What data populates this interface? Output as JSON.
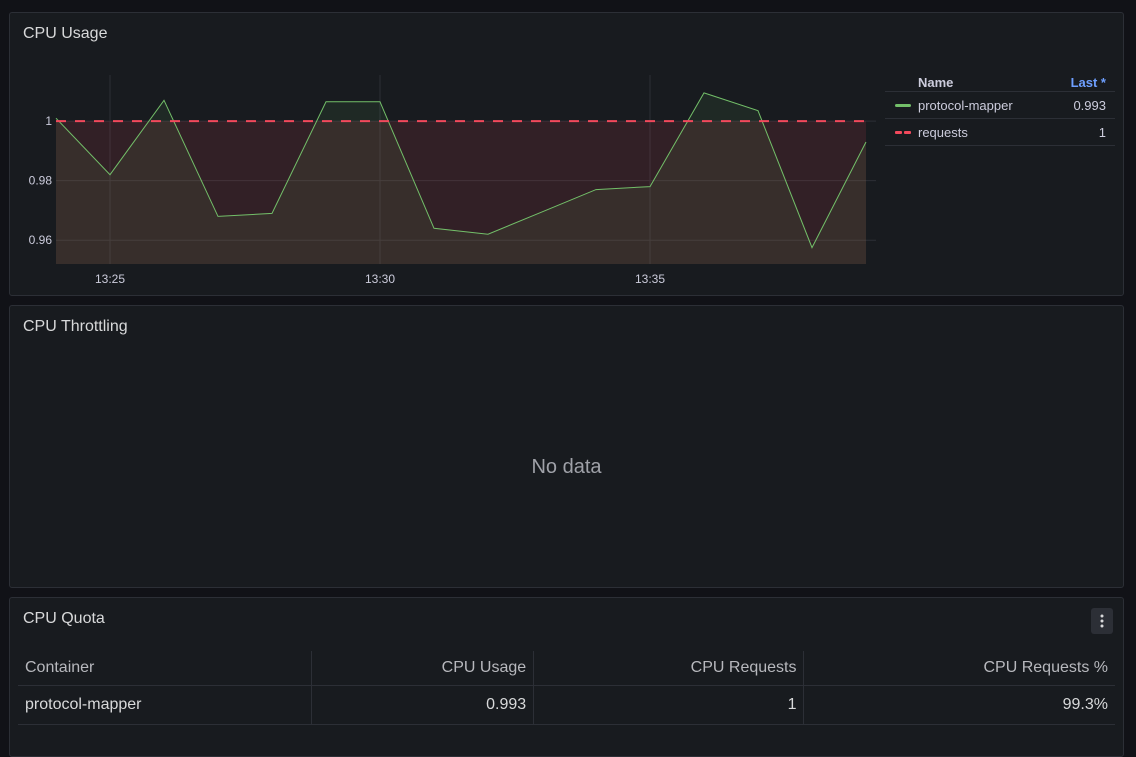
{
  "panels": {
    "cpu_usage": {
      "title": "CPU Usage"
    },
    "cpu_throttling": {
      "title": "CPU Throttling",
      "no_data_text": "No data"
    },
    "cpu_quota": {
      "title": "CPU Quota",
      "menu_icon": "more-vertical-icon"
    }
  },
  "legend": {
    "headers": {
      "name": "Name",
      "last": "Last *"
    },
    "items": [
      {
        "name": "protocol-mapper",
        "last": "0.993",
        "color": "#73bf69",
        "style": "solid"
      },
      {
        "name": "requests",
        "last": "1",
        "color": "#f2495c",
        "style": "dashed"
      }
    ]
  },
  "table": {
    "headers": [
      "Container",
      "CPU Usage",
      "CPU Requests",
      "CPU Requests %"
    ],
    "rows": [
      [
        "protocol-mapper",
        "0.993",
        "1",
        "99.3%"
      ]
    ]
  },
  "chart_data": {
    "type": "line",
    "title": "CPU Usage",
    "x_tick_labels": [
      "13:25",
      "13:30",
      "13:35"
    ],
    "y_tick_labels": [
      "0.96",
      "0.98",
      "1"
    ],
    "ylim": [
      0.952,
      1.0155
    ],
    "grid": true,
    "legend_position": "right",
    "series": [
      {
        "name": "protocol-mapper",
        "color": "#73bf69",
        "style": "solid",
        "x": [
          "13:24",
          "13:25",
          "13:26",
          "13:27",
          "13:28",
          "13:29",
          "13:30",
          "13:31",
          "13:32",
          "13:33",
          "13:34",
          "13:35",
          "13:36",
          "13:37",
          "13:38",
          "13:39"
        ],
        "values": [
          1.001,
          0.982,
          1.007,
          0.968,
          0.969,
          1.0065,
          1.0065,
          0.964,
          0.962,
          0.9695,
          0.977,
          0.978,
          1.0095,
          1.0035,
          0.9575,
          0.993
        ]
      },
      {
        "name": "requests",
        "color": "#f2495c",
        "style": "dashed",
        "x": [
          "13:24",
          "13:39"
        ],
        "values": [
          1,
          1
        ]
      }
    ]
  }
}
